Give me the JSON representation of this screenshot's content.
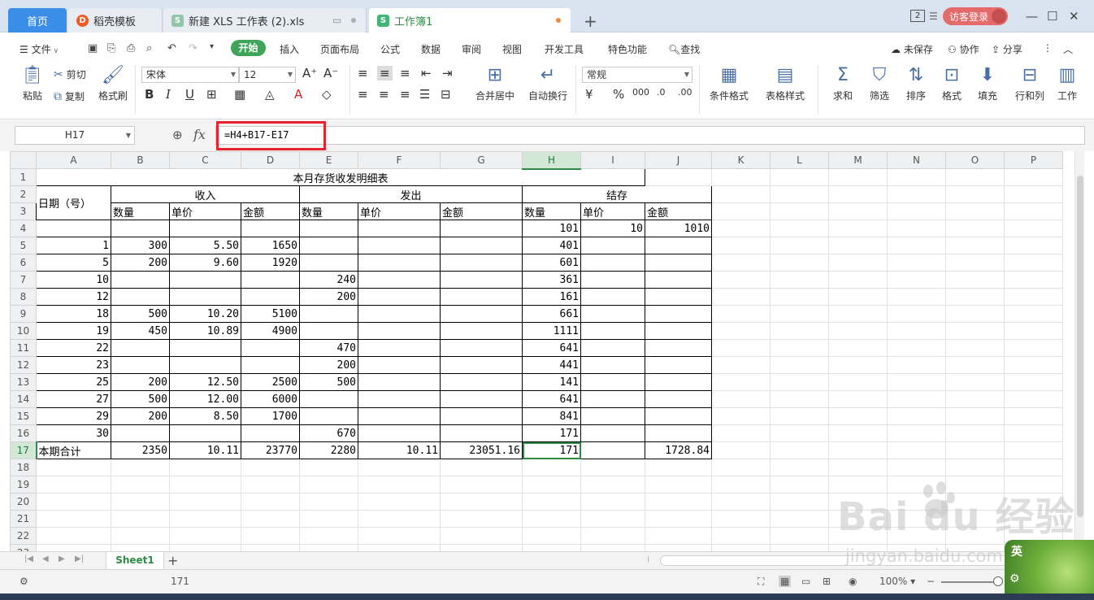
{
  "tabs": {
    "home": "首页",
    "templates": "稻壳模板",
    "doc": "新建 XLS 工作表 (2).xls",
    "active": "工作簿1",
    "window_count": "2",
    "login": "访客登录"
  },
  "menu": {
    "file": "文件",
    "start": "开始",
    "items": [
      "插入",
      "页面布局",
      "公式",
      "数据",
      "审阅",
      "视图",
      "开发工具",
      "特色功能"
    ],
    "search": "查找",
    "unsaved": "未保存",
    "collab": "协作",
    "share": "分享"
  },
  "ribbon": {
    "paste": "粘贴",
    "cut": "剪切",
    "copy": "复制",
    "format_painter": "格式刷",
    "font_name": "宋体",
    "font_size": "12",
    "merge_center": "合并居中",
    "auto_wrap": "自动换行",
    "number_format": "常规",
    "cond_format": "条件格式",
    "table_style": "表格样式",
    "sum": "求和",
    "filter": "筛选",
    "sort": "排序",
    "cell_format": "格式",
    "fill": "填充",
    "row_col": "行和列",
    "worksheet": "工作"
  },
  "formula_bar": {
    "cell_ref": "H17",
    "fx": "fx",
    "formula": "=H4+B17-E17"
  },
  "grid": {
    "columns": [
      "A",
      "B",
      "C",
      "D",
      "E",
      "F",
      "G",
      "H",
      "I",
      "J",
      "K",
      "L",
      "M",
      "N",
      "O",
      "P"
    ],
    "title": "本月存货收发明细表",
    "date_header": "日期（号）",
    "groups": [
      "收入",
      "发出",
      "结存"
    ],
    "sub_headers": [
      "数量",
      "单价",
      "金额"
    ],
    "rows": [
      {
        "a": "",
        "b": "",
        "c": "",
        "d": "",
        "e": "",
        "f": "",
        "g": "",
        "h": "101",
        "i": "10",
        "j": "1010"
      },
      {
        "a": "1",
        "b": "300",
        "c": "5.50",
        "d": "1650",
        "e": "",
        "f": "",
        "g": "",
        "h": "401",
        "i": "",
        "j": ""
      },
      {
        "a": "5",
        "b": "200",
        "c": "9.60",
        "d": "1920",
        "e": "",
        "f": "",
        "g": "",
        "h": "601",
        "i": "",
        "j": ""
      },
      {
        "a": "10",
        "b": "",
        "c": "",
        "d": "",
        "e": "240",
        "f": "",
        "g": "",
        "h": "361",
        "i": "",
        "j": ""
      },
      {
        "a": "12",
        "b": "",
        "c": "",
        "d": "",
        "e": "200",
        "f": "",
        "g": "",
        "h": "161",
        "i": "",
        "j": ""
      },
      {
        "a": "18",
        "b": "500",
        "c": "10.20",
        "d": "5100",
        "e": "",
        "f": "",
        "g": "",
        "h": "661",
        "i": "",
        "j": ""
      },
      {
        "a": "19",
        "b": "450",
        "c": "10.89",
        "d": "4900",
        "e": "",
        "f": "",
        "g": "",
        "h": "1111",
        "i": "",
        "j": ""
      },
      {
        "a": "22",
        "b": "",
        "c": "",
        "d": "",
        "e": "470",
        "f": "",
        "g": "",
        "h": "641",
        "i": "",
        "j": ""
      },
      {
        "a": "23",
        "b": "",
        "c": "",
        "d": "",
        "e": "200",
        "f": "",
        "g": "",
        "h": "441",
        "i": "",
        "j": ""
      },
      {
        "a": "25",
        "b": "200",
        "c": "12.50",
        "d": "2500",
        "e": "500",
        "f": "",
        "g": "",
        "h": "141",
        "i": "",
        "j": ""
      },
      {
        "a": "27",
        "b": "500",
        "c": "12.00",
        "d": "6000",
        "e": "",
        "f": "",
        "g": "",
        "h": "641",
        "i": "",
        "j": ""
      },
      {
        "a": "29",
        "b": "200",
        "c": "8.50",
        "d": "1700",
        "e": "",
        "f": "",
        "g": "",
        "h": "841",
        "i": "",
        "j": ""
      },
      {
        "a": "30",
        "b": "",
        "c": "",
        "d": "",
        "e": "670",
        "f": "",
        "g": "",
        "h": "171",
        "i": "",
        "j": ""
      }
    ],
    "total": {
      "a": "本期合计",
      "b": "2350",
      "c": "10.11",
      "d": "23770",
      "e": "2280",
      "f": "10.11",
      "g": "23051.16",
      "h": "171",
      "i": "",
      "j": "1728.84"
    }
  },
  "sheets": [
    "Sheet1"
  ],
  "status": {
    "value": "171",
    "zoom": "100%"
  },
  "watermark": {
    "brand": "Bai  du 经验",
    "url": "jingyan.baidu.com"
  },
  "ime": {
    "label": "英"
  },
  "colors": {
    "accent_green": "#2e8b46",
    "tab_blue": "#3b8ee8",
    "highlight_red": "#e8222c",
    "login_red": "#e56a6a"
  }
}
